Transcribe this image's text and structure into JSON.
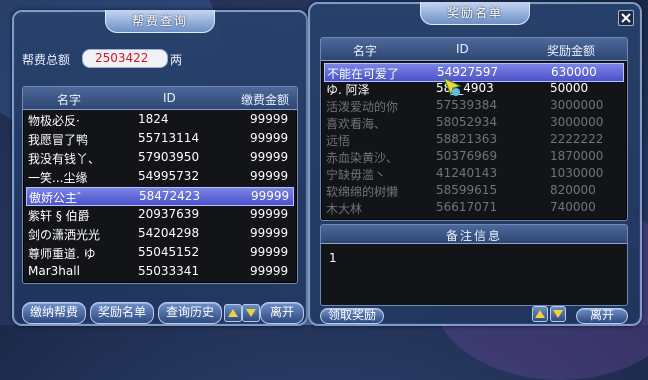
{
  "left_panel": {
    "title": "帮费查询",
    "total_label": "帮费总额",
    "total_value": "2503422",
    "total_unit": "两",
    "columns": [
      "名字",
      "ID",
      "缴费金额"
    ],
    "rows": [
      {
        "name": "物极必反·",
        "id": "1824",
        "amount": "99999"
      },
      {
        "name": "我愿冒了鸭",
        "id": "55713114",
        "amount": "99999"
      },
      {
        "name": "我没有钱丫、",
        "id": "57903950",
        "amount": "99999"
      },
      {
        "name": "一笑...尘缘",
        "id": "54995732",
        "amount": "99999"
      },
      {
        "name": "傲娇公主゛",
        "id": "58472423",
        "amount": "99999"
      },
      {
        "name": "紫轩 § 伯爵",
        "id": "20937639",
        "amount": "99999"
      },
      {
        "name": "剑の潇洒光光",
        "id": "54204298",
        "amount": "99999"
      },
      {
        "name": "尊师重道. ゆ",
        "id": "55045152",
        "amount": "99999"
      },
      {
        "name": "Mar3hall",
        "id": "55033341",
        "amount": "99999"
      }
    ],
    "selected_index": 4,
    "buttons": {
      "pay": "缴纳帮费",
      "reward_list": "奖励名单",
      "history": "查询历史",
      "leave": "离开"
    }
  },
  "right_panel": {
    "title": "奖励名单",
    "columns": [
      "名字",
      "ID",
      "奖励金额"
    ],
    "rows": [
      {
        "name": "不能在可爱了",
        "id": "54927597",
        "amount": "630000"
      },
      {
        "name": "ゆ. 阿泽",
        "id": "58__4903",
        "amount": "50000"
      },
      {
        "name": "活泼爱动的你",
        "id": "57539384",
        "amount": "3000000"
      },
      {
        "name": "喜欢看海、",
        "id": "58052934",
        "amount": "3000000"
      },
      {
        "name": "远悟",
        "id": "58821363",
        "amount": "2222222"
      },
      {
        "name": "赤血染黄沙、",
        "id": "50376969",
        "amount": "1870000"
      },
      {
        "name": "宁缺毋滥丶",
        "id": "41240143",
        "amount": "1030000"
      },
      {
        "name": "软绵绵的树懒",
        "id": "58599615",
        "amount": "820000"
      },
      {
        "name": "木大林",
        "id": "56617071",
        "amount": "740000"
      }
    ],
    "selected_index": 0,
    "notes_label": "备注信息",
    "notes_value": "1",
    "buttons": {
      "claim": "领取奖励",
      "leave": "离开"
    }
  },
  "colors": {
    "selected_row": "#5b62d6",
    "name_text": "#ffffff",
    "id_text": "#ffffff",
    "dim_text": "#6e737d",
    "total_field": "#f2f2f6",
    "total_value_color": "#d01820"
  },
  "icons": [
    "close-icon",
    "arrow-up-icon",
    "arrow-down-icon",
    "cursor-icon"
  ]
}
